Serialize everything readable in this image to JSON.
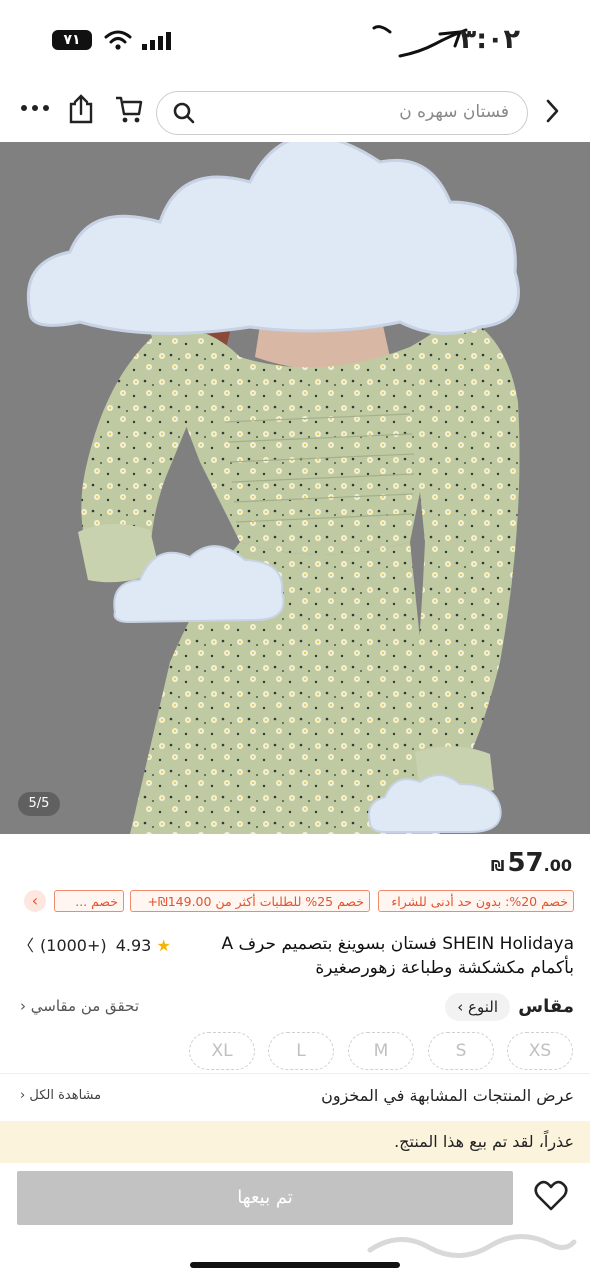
{
  "status_bar": {
    "time": "٣:٠٢",
    "battery": "٧١"
  },
  "top_bar": {
    "search_placeholder": "فستان سهره ن"
  },
  "image": {
    "counter": "5/5"
  },
  "product": {
    "price_currency": "₪",
    "price_int": "57",
    "price_dec": ".00",
    "promo_tags": [
      "خصم 20%: بدون حد أدنى للشراء",
      "خصم 25% للطلبات أكثر من 149.00₪+",
      "خصم ..."
    ],
    "title": "SHEIN Holidaya فستان بسوينغ بتصميم حرف A بأكمام مكشكشة وطباعة زهورصغيرة",
    "rating_value": "4.93",
    "rating_count": "(1000+)"
  },
  "size_section": {
    "label": "مقاس",
    "type_label": "النوع",
    "check_my_size": "تحقق من مقاسي",
    "sizes": [
      "XS",
      "S",
      "M",
      "L",
      "XL"
    ]
  },
  "similar": {
    "title": "عرض المنتجات المشابهة في المخزون",
    "view_all": "مشاهدة الكل"
  },
  "soldout": {
    "message": "عذراً، لقد تم بيع هذا المنتج."
  },
  "action": {
    "sold_button": "تم بيعها"
  },
  "colors": {
    "accent": "#e0542f",
    "banner": "#fbf3dc",
    "disabled_button": "#c2c2c2",
    "dress": "#bcc9a0"
  },
  "icons": [
    "wifi-icon",
    "signal-icon",
    "battery-icon",
    "more-icon",
    "share-icon",
    "cart-icon",
    "search-icon",
    "back-chevron-icon",
    "star-icon",
    "chevron-right-icon",
    "chevron-left-icon",
    "heart-icon"
  ]
}
